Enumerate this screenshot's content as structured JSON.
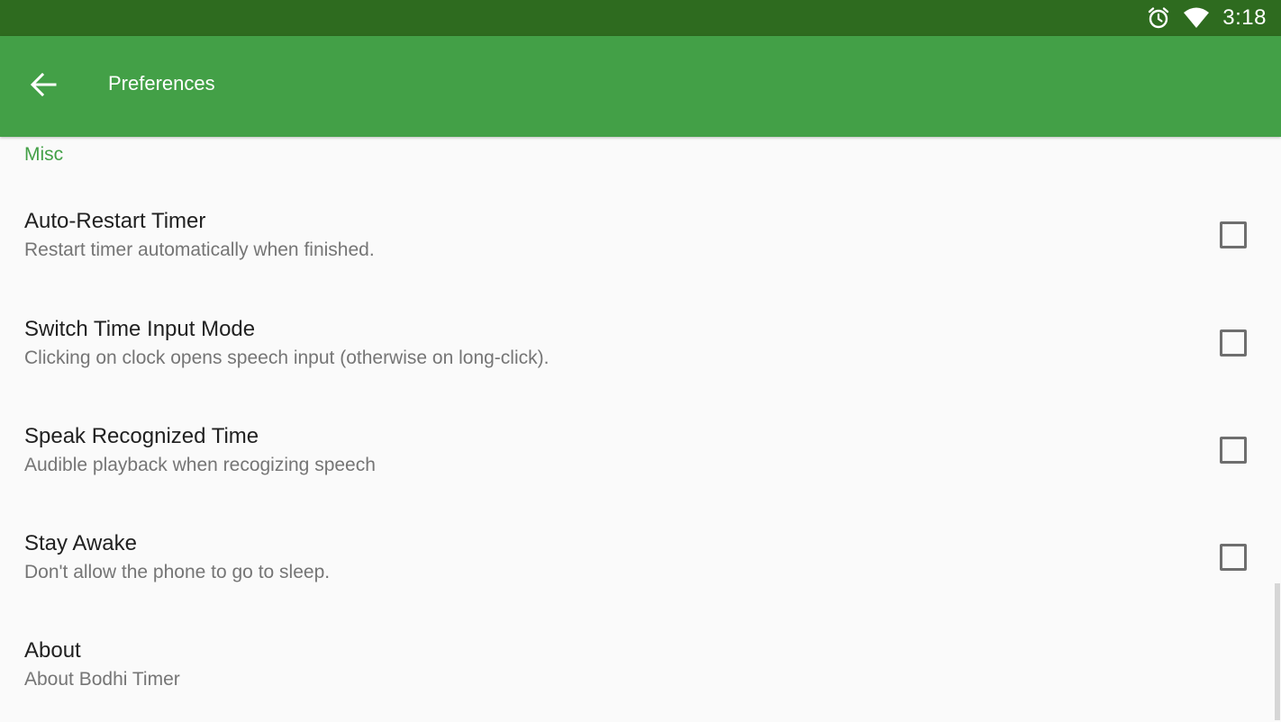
{
  "status_bar": {
    "icons": [
      "alarm-icon",
      "wifi-icon"
    ],
    "time": "3:18"
  },
  "app_bar": {
    "back_icon": "arrow-back-icon",
    "title": "Preferences",
    "color": "#43a047"
  },
  "section": {
    "header": "Misc",
    "accent_color": "#43a047"
  },
  "preferences": [
    {
      "title": "Auto-Restart Timer",
      "summary": "Restart timer automatically when finished.",
      "checked": false
    },
    {
      "title": "Switch Time Input Mode",
      "summary": "Clicking on clock opens speech input (otherwise on long-click).",
      "checked": false
    },
    {
      "title": "Speak Recognized Time",
      "summary": "Audible playback when recogizing speech",
      "checked": false
    },
    {
      "title": "Stay Awake",
      "summary": "Don't allow the phone to go to sleep.",
      "checked": false
    },
    {
      "title": "About",
      "summary": "About Bodhi Timer"
    }
  ]
}
